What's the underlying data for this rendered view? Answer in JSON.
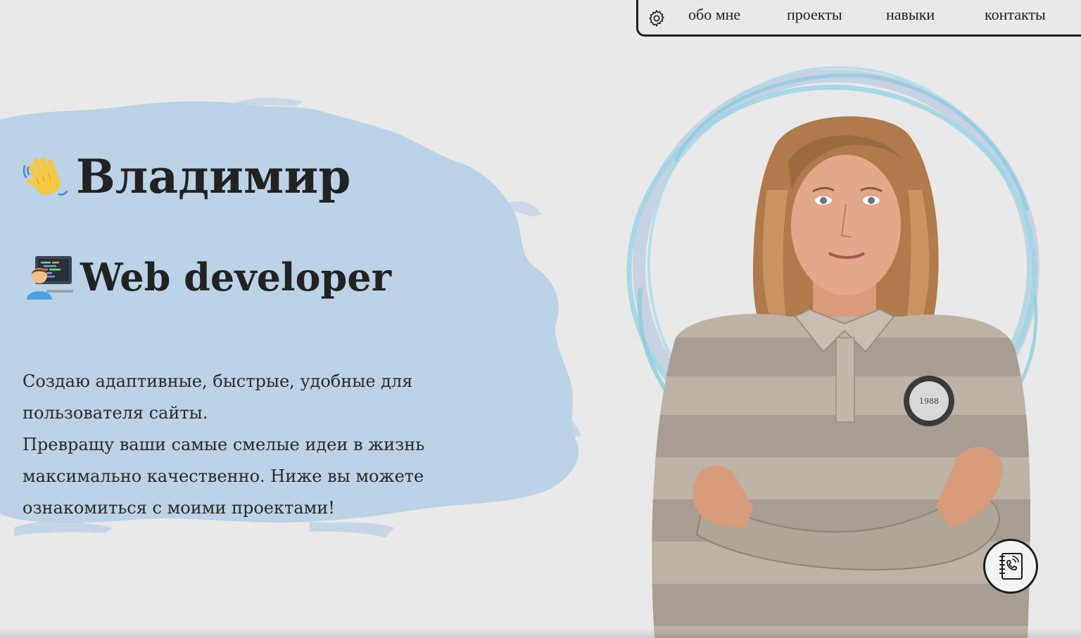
{
  "nav": {
    "links": [
      {
        "label": "обо мне"
      },
      {
        "label": "проекты"
      },
      {
        "label": "навыки"
      },
      {
        "label": "контакты"
      }
    ],
    "settings_icon": "gear-icon"
  },
  "hero": {
    "name": "Владимир",
    "role": "Web developer",
    "name_icon": "waving-hand-emoji",
    "role_icon": "technologist-emoji",
    "about_lines": [
      "Создаю адаптивные, быстрые, удобные для пользователя сайты.",
      "Превращу ваши самые смелые идеи в жизнь максимально качественно. Ниже вы можете ознакомиться с моими проектами!"
    ]
  },
  "portrait": {
    "alt": "portrait-photo",
    "ring_color": "#9fd6e6",
    "ring_color_secondary": "#b8c8de"
  },
  "contact_button": {
    "icon": "phone-book-icon"
  },
  "colors": {
    "background": "#e9e9e9",
    "brush": "#bcd2e6",
    "text": "#222222",
    "border": "#1e1e1e"
  }
}
